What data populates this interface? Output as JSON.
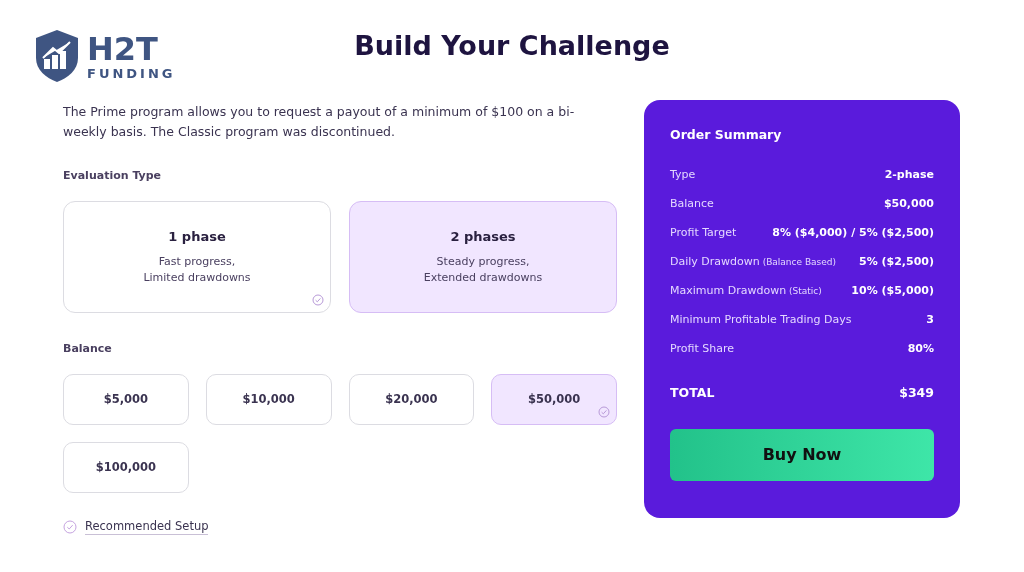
{
  "logo": {
    "name": "H2T",
    "tagline": "FUNDING"
  },
  "title": "Build Your Challenge",
  "intro": "The Prime program allows you to request a payout of a minimum of $100 on a bi-weekly basis. The Classic program was discontinued.",
  "evaluation": {
    "label": "Evaluation Type",
    "options": [
      {
        "title": "1 phase",
        "lines": [
          "Fast progress,",
          "Limited drawdowns"
        ],
        "selected": false,
        "checked": true
      },
      {
        "title": "2 phases",
        "lines": [
          "Steady progress,",
          "Extended drawdowns"
        ],
        "selected": true,
        "checked": false
      }
    ]
  },
  "balance": {
    "label": "Balance",
    "options": [
      {
        "label": "$5,000",
        "selected": false,
        "checked": false
      },
      {
        "label": "$10,000",
        "selected": false,
        "checked": false
      },
      {
        "label": "$20,000",
        "selected": false,
        "checked": false
      },
      {
        "label": "$50,000",
        "selected": true,
        "checked": true
      },
      {
        "label": "$100,000",
        "selected": false,
        "checked": false
      }
    ]
  },
  "recommended": "Recommended Setup",
  "summary": {
    "title": "Order Summary",
    "rows": [
      {
        "label": "Type",
        "value": "2-phase"
      },
      {
        "label": "Balance",
        "value": "$50,000"
      },
      {
        "label": "Profit Target",
        "value": "8% ($4,000) / 5% ($2,500)"
      },
      {
        "label": "Daily Drawdown",
        "note": "(Balance Based)",
        "value": "5% ($2,500)"
      },
      {
        "label": "Maximum Drawdown",
        "note": "(Static)",
        "value": "10% ($5,000)"
      },
      {
        "label": "Minimum Profitable Trading Days",
        "value": "3"
      },
      {
        "label": "Profit Share",
        "value": "80%"
      }
    ],
    "total_label": "TOTAL",
    "total": "$349",
    "button": "Buy Now"
  }
}
